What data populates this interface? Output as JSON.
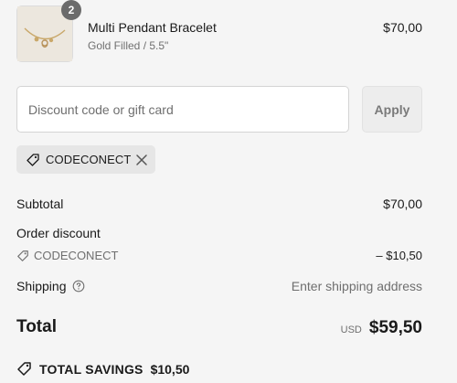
{
  "product": {
    "name": "Multi Pendant Bracelet",
    "variant": "Gold Filled / 5.5\"",
    "price": "$70,00",
    "quantity": "2",
    "thumbnail_icon": "bracelet-image"
  },
  "discount": {
    "placeholder": "Discount code or gift card",
    "value": "",
    "apply_label": "Apply"
  },
  "applied_code": {
    "code": "CODECONECT",
    "tag_icon": "tag-icon",
    "remove_icon": "close-icon"
  },
  "summary": {
    "subtotal_label": "Subtotal",
    "subtotal_value": "$70,00",
    "order_discount_label": "Order discount",
    "discount_code": "CODECONECT",
    "discount_amount": "– $10,50",
    "shipping_label": "Shipping",
    "shipping_value": "Enter shipping address",
    "total_label": "Total",
    "currency": "USD",
    "total_value": "$59,50"
  },
  "savings": {
    "label": "TOTAL SAVINGS",
    "amount": "$10,50"
  },
  "colors": {
    "background": "#f5f5f5",
    "badge": "#6b6b6b",
    "chip": "#e6e6e6",
    "muted_text": "#6f6f6f"
  }
}
